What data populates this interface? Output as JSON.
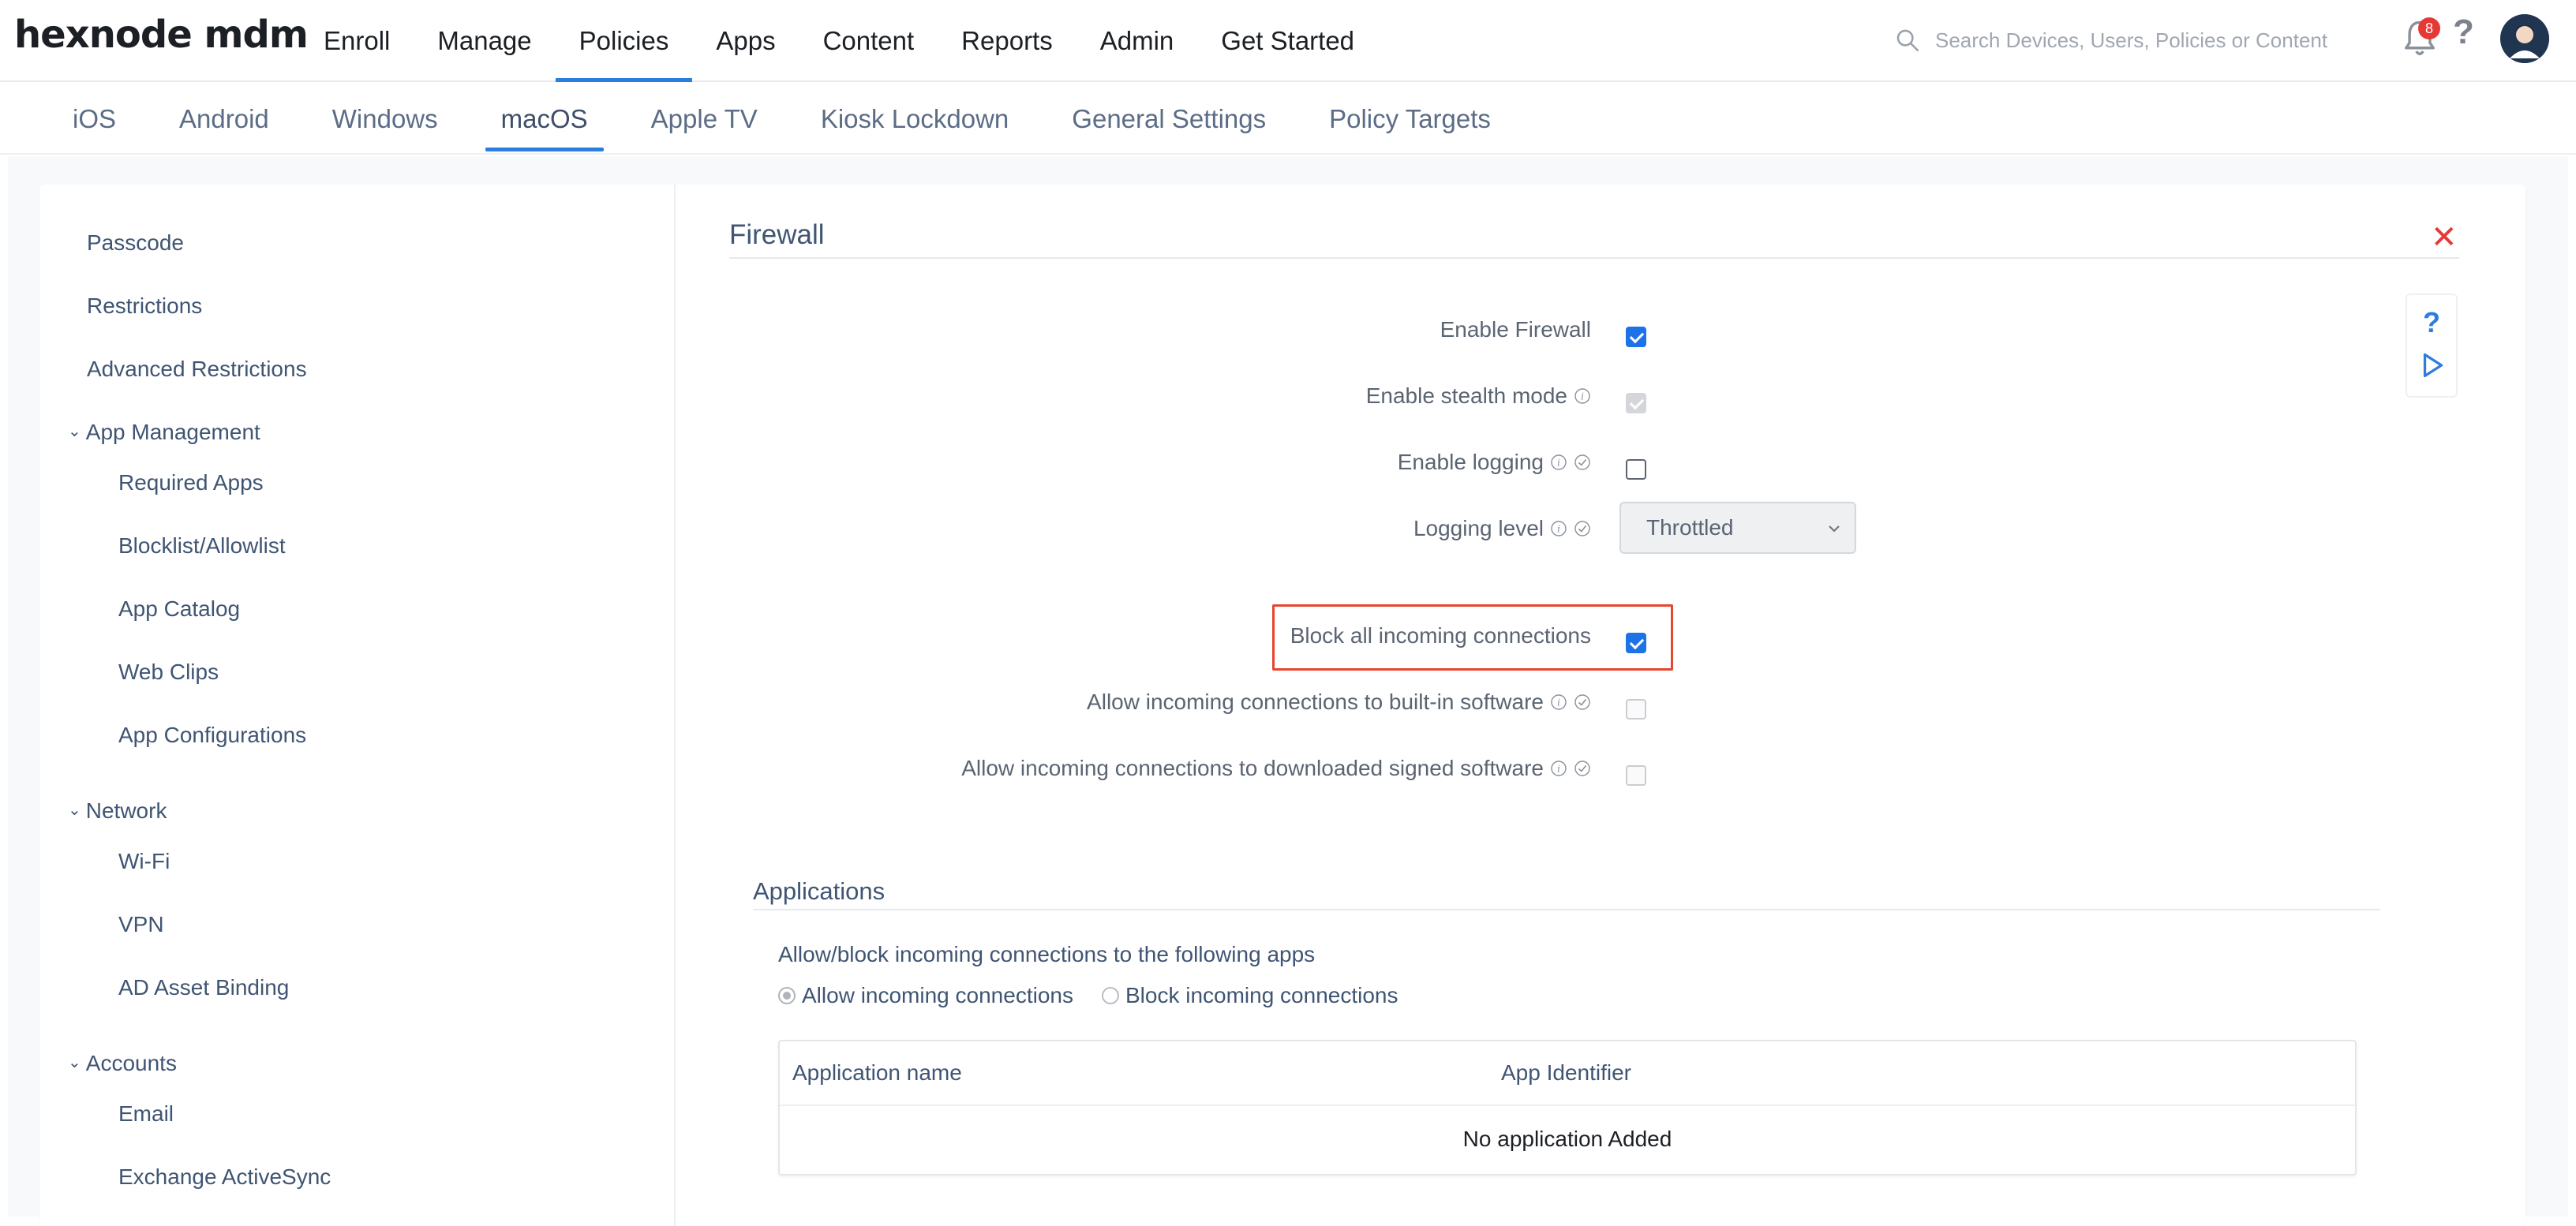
{
  "brand": {
    "logo_text": "hexnode mdm"
  },
  "main_nav": [
    {
      "label": "Enroll",
      "active": false
    },
    {
      "label": "Manage",
      "active": false
    },
    {
      "label": "Policies",
      "active": true
    },
    {
      "label": "Apps",
      "active": false
    },
    {
      "label": "Content",
      "active": false
    },
    {
      "label": "Reports",
      "active": false
    },
    {
      "label": "Admin",
      "active": false
    },
    {
      "label": "Get Started",
      "active": false
    }
  ],
  "search": {
    "placeholder": "Search Devices, Users, Policies or Content"
  },
  "notifications": {
    "count": "8"
  },
  "help_symbol": "?",
  "os_tabs": [
    {
      "label": "iOS"
    },
    {
      "label": "Android"
    },
    {
      "label": "Windows"
    },
    {
      "label": "macOS",
      "active": true
    },
    {
      "label": "Apple TV"
    },
    {
      "label": "Kiosk Lockdown"
    },
    {
      "label": "General Settings"
    },
    {
      "label": "Policy Targets"
    }
  ],
  "sidebar": {
    "items": [
      {
        "label": "Passcode",
        "type": "item"
      },
      {
        "label": "Restrictions",
        "type": "item"
      },
      {
        "label": "Advanced Restrictions",
        "type": "item"
      },
      {
        "label": "App Management",
        "type": "group"
      },
      {
        "label": "Required Apps",
        "type": "sub"
      },
      {
        "label": "Blocklist/Allowlist",
        "type": "sub"
      },
      {
        "label": "App Catalog",
        "type": "sub"
      },
      {
        "label": "Web Clips",
        "type": "sub"
      },
      {
        "label": "App Configurations",
        "type": "sub"
      },
      {
        "label": "Network",
        "type": "group"
      },
      {
        "label": "Wi-Fi",
        "type": "sub"
      },
      {
        "label": "VPN",
        "type": "sub"
      },
      {
        "label": "AD Asset Binding",
        "type": "sub"
      },
      {
        "label": "Accounts",
        "type": "group"
      },
      {
        "label": "Email",
        "type": "sub"
      },
      {
        "label": "Exchange ActiveSync",
        "type": "sub"
      }
    ]
  },
  "firewall": {
    "title": "Firewall",
    "close_symbol": "✕",
    "rows": [
      {
        "label": "Enable Firewall",
        "info": false,
        "check_icon": false,
        "state": "checked"
      },
      {
        "label": "Enable stealth mode",
        "info": true,
        "check_icon": false,
        "state": "disabled-checked"
      },
      {
        "label": "Enable logging",
        "info": true,
        "check_icon": true,
        "state": "unchecked"
      },
      {
        "label": "Logging level",
        "info": true,
        "check_icon": true,
        "state": "select"
      },
      {
        "label": "Block all incoming connections",
        "info": false,
        "check_icon": false,
        "state": "checked"
      },
      {
        "label": "Allow incoming connections to built-in software",
        "info": true,
        "check_icon": true,
        "state": "disabled"
      },
      {
        "label": "Allow incoming connections to downloaded signed software",
        "info": true,
        "check_icon": true,
        "state": "disabled"
      }
    ],
    "logging_level_value": "Throttled"
  },
  "applications": {
    "title": "Applications",
    "description": "Allow/block incoming connections to the following apps",
    "radio_allow": "Allow incoming connections",
    "radio_block": "Block incoming connections",
    "selected": "allow",
    "table": {
      "col_name": "Application name",
      "col_identifier": "App Identifier",
      "empty_text": "No application Added"
    }
  },
  "colors": {
    "accent": "#2b7de0",
    "checkbox_blue": "#1d72e8",
    "highlight_red": "#e8452e",
    "close_red": "#e53935"
  }
}
